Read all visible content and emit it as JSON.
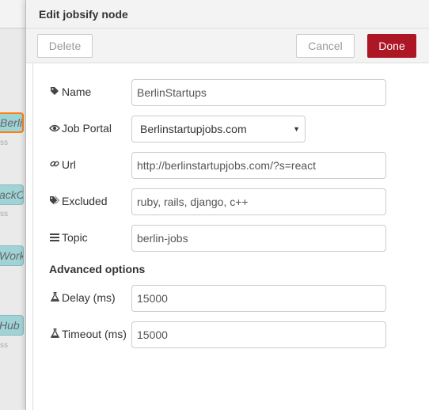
{
  "workspace": {
    "nodes": [
      {
        "label": "BerlinSt",
        "status": "ss"
      },
      {
        "label": "ackOv",
        "status": "ss"
      },
      {
        "label": "WorkR",
        "status": ""
      },
      {
        "label": "Hub J",
        "status": "ss"
      }
    ]
  },
  "tray": {
    "title": "Edit jobsify node",
    "delete_label": "Delete",
    "cancel_label": "Cancel",
    "done_label": "Done"
  },
  "form": {
    "name": {
      "label": "Name",
      "value": "BerlinStartups",
      "icon": "tag-icon"
    },
    "job_portal": {
      "label": "Job Portal",
      "value": "Berlinstartupjobs.com",
      "icon": "eye-icon"
    },
    "url": {
      "label": "Url",
      "value": "http://berlinstartupjobs.com/?s=react",
      "icon": "link-icon"
    },
    "excluded": {
      "label": "Excluded",
      "value": "ruby, rails, django, c++",
      "icon": "tags-icon"
    },
    "topic": {
      "label": "Topic",
      "value": "berlin-jobs",
      "icon": "list-icon"
    },
    "advanced_title": "Advanced options",
    "delay": {
      "label": "Delay (ms)",
      "value": "15000",
      "icon": "flask-icon"
    },
    "timeout": {
      "label": "Timeout (ms)",
      "value": "15000",
      "icon": "flask-icon"
    }
  },
  "colors": {
    "done_button": "#ad1625",
    "node_fill": "#9fd3d6",
    "selected_border": "#ff7f0e"
  }
}
